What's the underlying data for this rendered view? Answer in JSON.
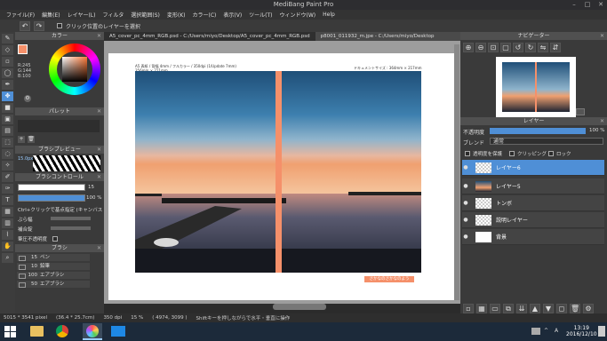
{
  "window": {
    "title": "MediBang Paint Pro"
  },
  "menu": [
    "ファイル(F)",
    "編集(E)",
    "レイヤー(L)",
    "フィルタ",
    "選択範囲(S)",
    "変形(K)",
    "カラー(C)",
    "表示(V)",
    "ツール(T)",
    "ウィンドウ(W)",
    "Help"
  ],
  "toolbar": {
    "checkbox_label": "クリック位置のレイヤーを選択"
  },
  "tabs": [
    "A5_cover_pc_4mm_RGB.psd - C:/Users/miyo/Desktop/A5_cover_pc_4mm_RGB.psd",
    "p8001_011932_m.jpe - C:/Users/miyo/Desktop"
  ],
  "color_panel": {
    "title": "カラー",
    "r": "R:245",
    "g": "G:144",
    "b": "B:100"
  },
  "palette_panel": {
    "title": "パレット"
  },
  "brush_preview": {
    "title": "ブラシプレビュー",
    "size": "15.0px"
  },
  "brush_control": {
    "title": "ブラシコントロール",
    "size_value": "15",
    "opacity_value": "100 %",
    "ctrl_label": "Ctrl+クリックで基点指定 (キャンバス)",
    "blur_label": "ぶら幅",
    "fill_label": "補合錠",
    "opacity_label": "筆圧不透明度"
  },
  "brush_panel": {
    "title": "ブラシ",
    "items": [
      {
        "size": "15",
        "name": "ペン"
      },
      {
        "size": "10",
        "name": "鉛筆"
      },
      {
        "size": "100",
        "name": "エアブラシ"
      },
      {
        "size": "50",
        "name": "エアブラシ"
      }
    ]
  },
  "document": {
    "header_left": "A5 表紙 / 背幅 4mm / フルカラー / 350dpi (1/Update 7mm)",
    "header_left2": "356mm × 211mm",
    "header_right": "ドキュメントサイズ : 364mm × 217mm",
    "stamp": "さかなのさかなのよう"
  },
  "navigator": {
    "title": "ナビゲーター"
  },
  "layer_panel": {
    "title": "レイヤー",
    "opacity_label": "不透明度",
    "opacity_value": "100 %",
    "blend_label": "ブレンド",
    "blend_value": "通常",
    "protect_label": "透明度を保護",
    "clipping_label": "クリッピング",
    "lock_label": "ロック",
    "layers": [
      {
        "name": "レイヤー6",
        "selected": true
      },
      {
        "name": "レイヤー5",
        "selected": false
      },
      {
        "name": "トンボ",
        "selected": false
      },
      {
        "name": "説明レイヤー",
        "selected": false
      },
      {
        "name": "背景",
        "selected": false
      }
    ]
  },
  "status": {
    "size": "5015 * 3541 pixel",
    "dim": "(36.4 * 25.7cm)",
    "dpi": "350 dpi",
    "zoom": "15 %",
    "coords": "( 4974, 3099 )",
    "hint": "Shiftキーを押しながらで水平・垂直に操作"
  },
  "taskbar": {
    "time": "13:19",
    "date": "2016/12/10",
    "ime": "A"
  },
  "colors": {
    "accent": "#4f8fd6",
    "orange": "#f5906a"
  }
}
